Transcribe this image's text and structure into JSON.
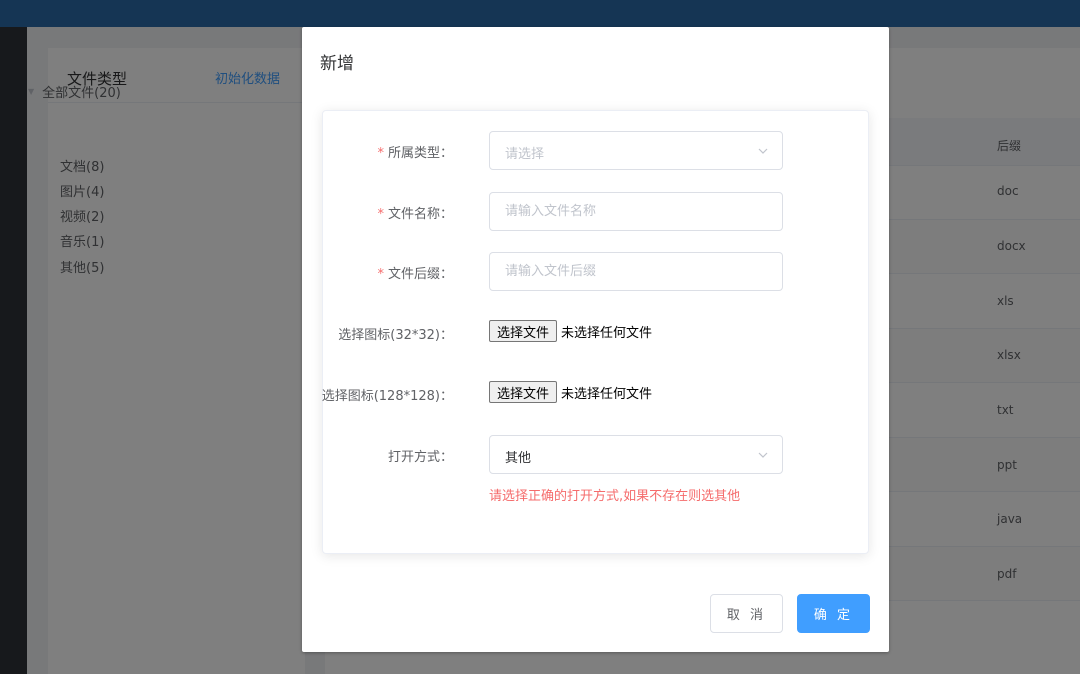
{
  "sidebar": {
    "title": "文件类型",
    "init_link": "初始化数据",
    "tree": {
      "root": "全部文件(20)",
      "children": [
        "文档(8)",
        "图片(4)",
        "视频(2)",
        "音乐(1)",
        "其他(5)"
      ]
    }
  },
  "table": {
    "suffix_header": "后缀",
    "suffixes": [
      "doc",
      "docx",
      "xls",
      "xlsx",
      "txt",
      "ppt",
      "java",
      "pdf"
    ]
  },
  "dialog": {
    "title": "新增",
    "fields": {
      "type": {
        "label": "所属类型：",
        "placeholder": "请选择"
      },
      "name": {
        "label": "文件名称：",
        "placeholder": "请输入文件名称"
      },
      "suffix": {
        "label": "文件后缀：",
        "placeholder": "请输入文件后缀"
      },
      "icon_small": {
        "label": "选择图标(32*32)：",
        "button": "选择文件",
        "status": "未选择任何文件"
      },
      "icon_large": {
        "label": "选择图标(128*128)：",
        "button": "选择文件",
        "status": "未选择任何文件"
      },
      "open_mode": {
        "label": "打开方式：",
        "value": "其他",
        "hint": "请选择正确的打开方式,如果不存在则选其他"
      }
    },
    "required_mark": "*",
    "cancel_label": "取 消",
    "confirm_label": "确 定"
  },
  "colors": {
    "primary": "#409eff",
    "danger": "#f56c6c",
    "topbar": "#2b6aa8"
  }
}
